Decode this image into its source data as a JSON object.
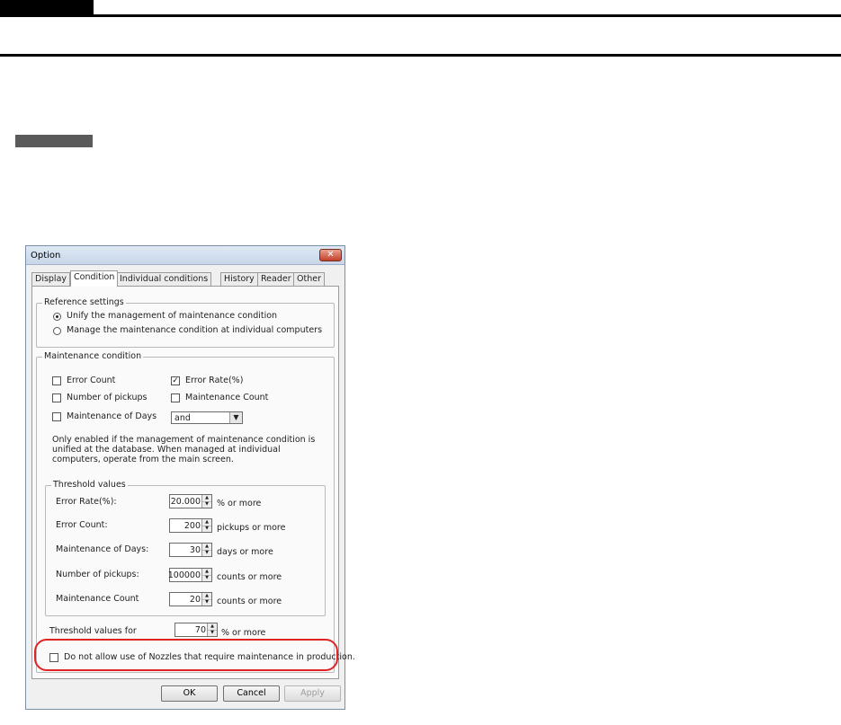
{
  "dialog": {
    "title": "Option",
    "close_glyph": "✕",
    "tabs": [
      "Display",
      "Condition",
      "Individual conditions",
      "History",
      "Reader",
      "Other"
    ],
    "active_tab": "Condition",
    "reference": {
      "legend": "Reference settings",
      "options": [
        {
          "label": "Unify the management of maintenance condition",
          "selected": true
        },
        {
          "label": "Manage the maintenance condition at individual computers",
          "selected": false
        }
      ]
    },
    "maintenance": {
      "legend": "Maintenance condition",
      "error_count": {
        "label": "Error Count",
        "checked": false
      },
      "error_rate": {
        "label": "Error Rate(%)",
        "checked": true
      },
      "pickups": {
        "label": "Number of pickups",
        "checked": false
      },
      "maint_count": {
        "label": "Maintenance Count",
        "checked": false
      },
      "maint_days": {
        "label": "Maintenance of Days",
        "checked": false
      },
      "combine_select": "and",
      "note": "Only enabled if the management of maintenance condition is unified at the database. When managed at individual computers, operate from the main screen."
    },
    "threshold": {
      "legend": "Threshold values",
      "rows": [
        {
          "label": "Error Rate(%):",
          "value": "20.000",
          "unit": "% or more"
        },
        {
          "label": "Error Count:",
          "value": "200",
          "unit": "pickups or more"
        },
        {
          "label": "Maintenance of Days:",
          "value": "30",
          "unit": "days or more"
        },
        {
          "label": "Number of pickups:",
          "value": "100000",
          "unit": "counts or more"
        },
        {
          "label": "Maintenance Count",
          "value": "20",
          "unit": "counts or more"
        }
      ]
    },
    "threshold_for": {
      "label": "Threshold values for",
      "value": "70",
      "unit": "% or more"
    },
    "disallow": {
      "label": "Do not allow use of Nozzles that require maintenance in production.",
      "checked": false
    },
    "buttons": {
      "ok": "OK",
      "cancel": "Cancel",
      "apply": "Apply"
    }
  },
  "colors": {
    "highlight": "#e02424",
    "rule": "#000000",
    "tag": "#5a5a5a"
  }
}
